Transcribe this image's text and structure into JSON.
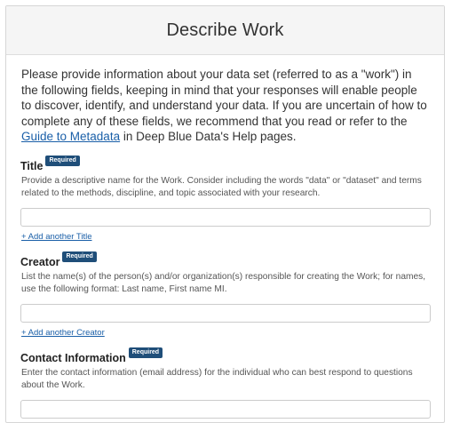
{
  "header": {
    "title": "Describe Work"
  },
  "intro": {
    "text_before": "Please provide information about your data set (referred to as a \"work\") in the following fields, keeping in mind that your responses will enable people to discover, identify, and understand your data. If you are uncertain of how to complete any of these fields, we recommend that you read or refer to the ",
    "link_text": "Guide to Metadata",
    "text_after": " in Deep Blue Data's Help pages."
  },
  "fields": {
    "title": {
      "label": "Title",
      "badge": "Required",
      "help": "Provide a descriptive name for the Work. Consider including the words \"data\" or \"dataset\" and terms related to the methods, discipline, and topic associated with your research.",
      "value": "",
      "add_link": "+ Add another Title"
    },
    "creator": {
      "label": "Creator",
      "badge": "Required",
      "help": "List the name(s) of the person(s) and/or organization(s) responsible for creating the Work; for names, use the following format: Last name, First name MI.",
      "value": "",
      "add_link": "+ Add another Creator"
    },
    "contact": {
      "label": "Contact Information",
      "badge": "Required",
      "help": "Enter the contact information (email address) for the individual who can best respond to questions about the Work.",
      "value": ""
    }
  }
}
